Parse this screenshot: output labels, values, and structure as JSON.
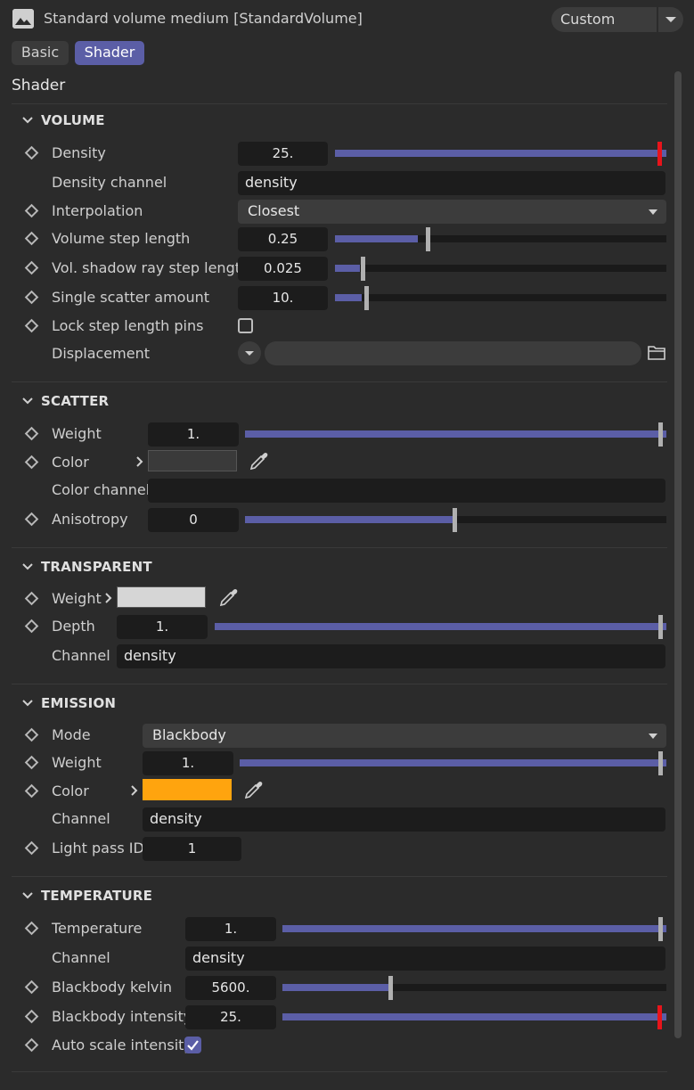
{
  "header": {
    "title": "Standard volume medium [StandardVolume]",
    "icon": "image-icon",
    "preset": "Custom"
  },
  "tabs": [
    {
      "label": "Basic",
      "active": false
    },
    {
      "label": "Shader",
      "active": true
    }
  ],
  "page_title": "Shader",
  "colors": {
    "accent": "#5b5ea6",
    "slider_max": "#e8141b",
    "emission_color": "#ffa40e",
    "scatter_color": "#3a3a3a",
    "transparent_weight_color": "#d6d6d6"
  },
  "volume": {
    "title": "VOLUME",
    "density": {
      "label": "Density",
      "value": "25.",
      "fraction": 1.0
    },
    "density_channel": {
      "label": "Density channel",
      "value": "density"
    },
    "interpolation": {
      "label": "Interpolation",
      "value": "Closest"
    },
    "step_length": {
      "label": "Volume step length",
      "value": "0.25",
      "fraction": 0.25
    },
    "shadow_step": {
      "label": "Vol. shadow ray step length",
      "value": "0.025",
      "fraction": 0.075
    },
    "single_scatter": {
      "label": "Single scatter amount",
      "value": "10.",
      "fraction": 0.08
    },
    "lock_pins": {
      "label": "Lock step length pins",
      "checked": false
    },
    "displacement": {
      "label": "Displacement",
      "value": ""
    }
  },
  "scatter": {
    "title": "SCATTER",
    "weight": {
      "label": "Weight",
      "value": "1.",
      "fraction": 1.0
    },
    "color": {
      "label": "Color"
    },
    "color_channel": {
      "label": "Color channel",
      "value": ""
    },
    "anisotropy": {
      "label": "Anisotropy",
      "value": "0",
      "fraction": 0.5
    }
  },
  "transparent": {
    "title": "TRANSPARENT",
    "weight": {
      "label": "Weight"
    },
    "depth": {
      "label": "Depth",
      "value": "1.",
      "fraction": 1.0
    },
    "channel": {
      "label": "Channel",
      "value": "density"
    }
  },
  "emission": {
    "title": "EMISSION",
    "mode": {
      "label": "Mode",
      "value": "Blackbody"
    },
    "weight": {
      "label": "Weight",
      "value": "1.",
      "fraction": 1.0
    },
    "color": {
      "label": "Color"
    },
    "channel": {
      "label": "Channel",
      "value": "density"
    },
    "light_pass_id": {
      "label": "Light pass ID",
      "value": "1"
    }
  },
  "temperature": {
    "title": "TEMPERATURE",
    "temperature": {
      "label": "Temperature",
      "value": "1.",
      "fraction": 1.0
    },
    "channel": {
      "label": "Channel",
      "value": "density"
    },
    "kelvin": {
      "label": "Blackbody kelvin",
      "value": "5600.",
      "fraction": 0.28
    },
    "intensity": {
      "label": "Blackbody intensity",
      "value": "25.",
      "fraction": 1.0
    },
    "auto_scale": {
      "label": "Auto scale intensity",
      "checked": true
    }
  }
}
